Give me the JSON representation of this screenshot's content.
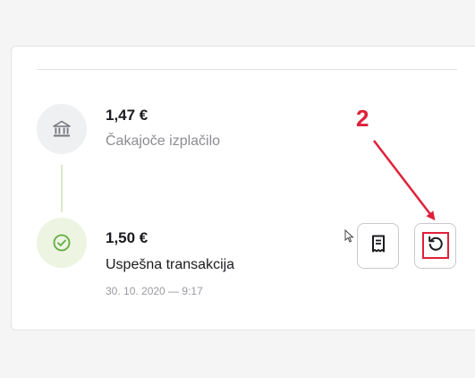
{
  "transactions": [
    {
      "amount": "1,47 €",
      "status": "Čakajoče izplačilo",
      "icon": "bank-icon"
    },
    {
      "amount": "1,50 €",
      "status": "Uspešna transakcija",
      "datetime": "30. 10. 2020 — 9:17",
      "icon": "check-circle-icon"
    }
  ],
  "actions": {
    "receipt_icon": "receipt-icon",
    "retry_icon": "refresh-icon"
  },
  "annotation": {
    "step_number": "2",
    "color": "#e0203a"
  },
  "colors": {
    "success": "#5fae3e",
    "neutral_icon": "#75767c"
  }
}
